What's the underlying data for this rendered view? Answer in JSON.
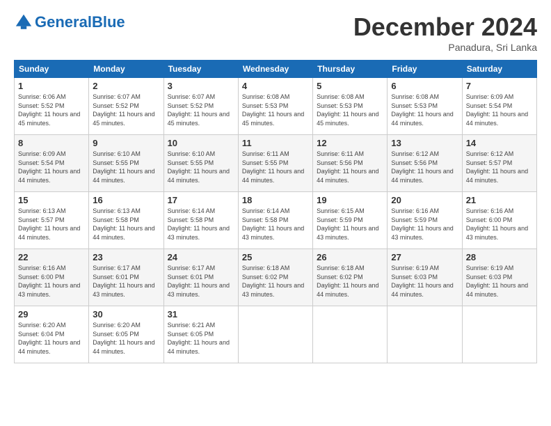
{
  "logo": {
    "text_general": "General",
    "text_blue": "Blue"
  },
  "header": {
    "month": "December 2024",
    "location": "Panadura, Sri Lanka"
  },
  "weekdays": [
    "Sunday",
    "Monday",
    "Tuesday",
    "Wednesday",
    "Thursday",
    "Friday",
    "Saturday"
  ],
  "weeks": [
    [
      {
        "day": 1,
        "sunrise": "6:06 AM",
        "sunset": "5:52 PM",
        "daylight": "11 hours and 45 minutes."
      },
      {
        "day": 2,
        "sunrise": "6:07 AM",
        "sunset": "5:52 PM",
        "daylight": "11 hours and 45 minutes."
      },
      {
        "day": 3,
        "sunrise": "6:07 AM",
        "sunset": "5:52 PM",
        "daylight": "11 hours and 45 minutes."
      },
      {
        "day": 4,
        "sunrise": "6:08 AM",
        "sunset": "5:53 PM",
        "daylight": "11 hours and 45 minutes."
      },
      {
        "day": 5,
        "sunrise": "6:08 AM",
        "sunset": "5:53 PM",
        "daylight": "11 hours and 45 minutes."
      },
      {
        "day": 6,
        "sunrise": "6:08 AM",
        "sunset": "5:53 PM",
        "daylight": "11 hours and 44 minutes."
      },
      {
        "day": 7,
        "sunrise": "6:09 AM",
        "sunset": "5:54 PM",
        "daylight": "11 hours and 44 minutes."
      }
    ],
    [
      {
        "day": 8,
        "sunrise": "6:09 AM",
        "sunset": "5:54 PM",
        "daylight": "11 hours and 44 minutes."
      },
      {
        "day": 9,
        "sunrise": "6:10 AM",
        "sunset": "5:55 PM",
        "daylight": "11 hours and 44 minutes."
      },
      {
        "day": 10,
        "sunrise": "6:10 AM",
        "sunset": "5:55 PM",
        "daylight": "11 hours and 44 minutes."
      },
      {
        "day": 11,
        "sunrise": "6:11 AM",
        "sunset": "5:55 PM",
        "daylight": "11 hours and 44 minutes."
      },
      {
        "day": 12,
        "sunrise": "6:11 AM",
        "sunset": "5:56 PM",
        "daylight": "11 hours and 44 minutes."
      },
      {
        "day": 13,
        "sunrise": "6:12 AM",
        "sunset": "5:56 PM",
        "daylight": "11 hours and 44 minutes."
      },
      {
        "day": 14,
        "sunrise": "6:12 AM",
        "sunset": "5:57 PM",
        "daylight": "11 hours and 44 minutes."
      }
    ],
    [
      {
        "day": 15,
        "sunrise": "6:13 AM",
        "sunset": "5:57 PM",
        "daylight": "11 hours and 44 minutes."
      },
      {
        "day": 16,
        "sunrise": "6:13 AM",
        "sunset": "5:58 PM",
        "daylight": "11 hours and 44 minutes."
      },
      {
        "day": 17,
        "sunrise": "6:14 AM",
        "sunset": "5:58 PM",
        "daylight": "11 hours and 43 minutes."
      },
      {
        "day": 18,
        "sunrise": "6:14 AM",
        "sunset": "5:58 PM",
        "daylight": "11 hours and 43 minutes."
      },
      {
        "day": 19,
        "sunrise": "6:15 AM",
        "sunset": "5:59 PM",
        "daylight": "11 hours and 43 minutes."
      },
      {
        "day": 20,
        "sunrise": "6:16 AM",
        "sunset": "5:59 PM",
        "daylight": "11 hours and 43 minutes."
      },
      {
        "day": 21,
        "sunrise": "6:16 AM",
        "sunset": "6:00 PM",
        "daylight": "11 hours and 43 minutes."
      }
    ],
    [
      {
        "day": 22,
        "sunrise": "6:16 AM",
        "sunset": "6:00 PM",
        "daylight": "11 hours and 43 minutes."
      },
      {
        "day": 23,
        "sunrise": "6:17 AM",
        "sunset": "6:01 PM",
        "daylight": "11 hours and 43 minutes."
      },
      {
        "day": 24,
        "sunrise": "6:17 AM",
        "sunset": "6:01 PM",
        "daylight": "11 hours and 43 minutes."
      },
      {
        "day": 25,
        "sunrise": "6:18 AM",
        "sunset": "6:02 PM",
        "daylight": "11 hours and 43 minutes."
      },
      {
        "day": 26,
        "sunrise": "6:18 AM",
        "sunset": "6:02 PM",
        "daylight": "11 hours and 44 minutes."
      },
      {
        "day": 27,
        "sunrise": "6:19 AM",
        "sunset": "6:03 PM",
        "daylight": "11 hours and 44 minutes."
      },
      {
        "day": 28,
        "sunrise": "6:19 AM",
        "sunset": "6:03 PM",
        "daylight": "11 hours and 44 minutes."
      }
    ],
    [
      {
        "day": 29,
        "sunrise": "6:20 AM",
        "sunset": "6:04 PM",
        "daylight": "11 hours and 44 minutes."
      },
      {
        "day": 30,
        "sunrise": "6:20 AM",
        "sunset": "6:05 PM",
        "daylight": "11 hours and 44 minutes."
      },
      {
        "day": 31,
        "sunrise": "6:21 AM",
        "sunset": "6:05 PM",
        "daylight": "11 hours and 44 minutes."
      },
      null,
      null,
      null,
      null
    ]
  ]
}
